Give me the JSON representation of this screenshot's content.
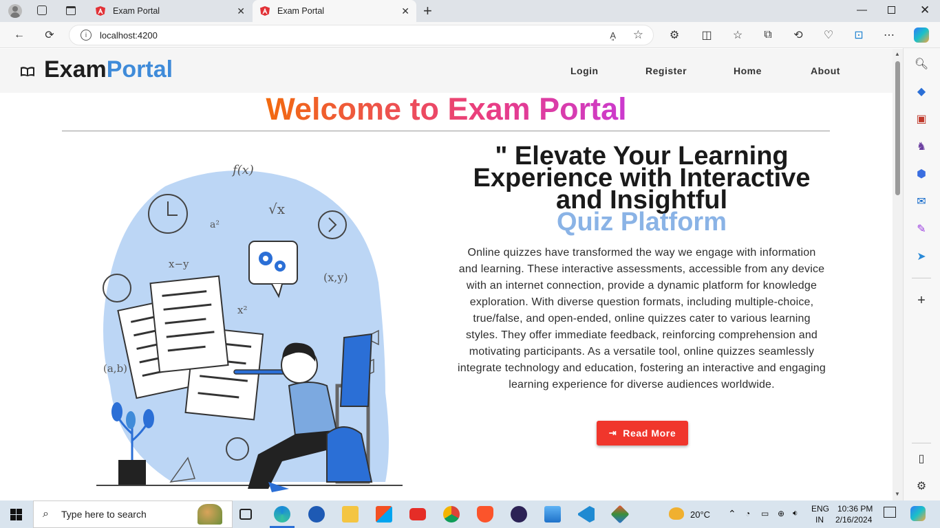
{
  "browser": {
    "tabs": [
      {
        "title": "Exam Portal",
        "active": false
      },
      {
        "title": "Exam Portal",
        "active": true
      }
    ],
    "new_tab": "+",
    "address": "localhost:4200"
  },
  "app": {
    "brand_part1": "Exam",
    "brand_part2": "Portal",
    "nav": [
      "Login",
      "Register",
      "Home",
      "About"
    ]
  },
  "hero": {
    "welcome": "Welcome to Exam Portal",
    "heading_line1": "\" Elevate Your Learning",
    "heading_line2": "Experience with Interactive",
    "heading_line3": "and Insightful",
    "heading_accent": "Quiz Platform",
    "description": "Online quizzes have transformed the way we engage with information and learning. These interactive assessments, accessible from any device with an internet connection, provide a dynamic platform for knowledge exploration. With diverse question formats, including multiple-choice, true/false, and open-ended, online quizzes cater to various learning styles. They offer immediate feedback, reinforcing comprehension and motivating participants. As a versatile tool, online quizzes seamlessly integrate technology and education, fostering an interactive and engaging learning experience for diverse audiences worldwide.",
    "button": "Read More"
  },
  "taskbar": {
    "search_placeholder": "Type here to search",
    "weather": "20°C",
    "lang1": "ENG",
    "lang2": "IN",
    "time": "10:36 PM",
    "date": "2/16/2024"
  },
  "colors": {
    "accent_blue": "#3f8bd9",
    "button_red": "#f0362c",
    "illustration_blue": "#bcd6f5"
  }
}
